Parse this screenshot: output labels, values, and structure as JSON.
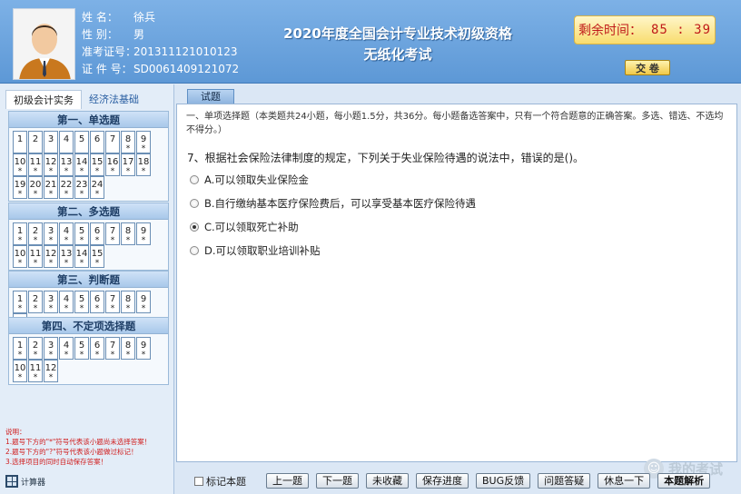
{
  "candidate": {
    "name_label": "姓    名：",
    "name": "徐兵",
    "gender_label": "性    别：",
    "gender": "男",
    "ticket_label": "准考证号：",
    "ticket": "201311121010123",
    "id_label": "证 件 号：",
    "id": "SD0061409121072"
  },
  "exam": {
    "title_line1": "2020年度全国会计专业技术初级资格",
    "title_line2": "无纸化考试"
  },
  "timer": {
    "label": "剩余时间：",
    "minutes": "85",
    "sep": ":",
    "seconds": "39"
  },
  "submit_label": "交 卷",
  "subject_tabs": [
    "初级会计实务",
    "经济法基础"
  ],
  "sections": [
    {
      "title": "第一、单选题",
      "items": [
        {
          "n": "1",
          "m": ""
        },
        {
          "n": "2",
          "m": ""
        },
        {
          "n": "3",
          "m": ""
        },
        {
          "n": "4",
          "m": ""
        },
        {
          "n": "5",
          "m": ""
        },
        {
          "n": "6",
          "m": ""
        },
        {
          "n": "7",
          "m": ""
        },
        {
          "n": "8",
          "m": "*"
        },
        {
          "n": "9",
          "m": "*"
        },
        {
          "n": "10",
          "m": "*"
        },
        {
          "n": "11",
          "m": "*"
        },
        {
          "n": "12",
          "m": "*"
        },
        {
          "n": "13",
          "m": "*"
        },
        {
          "n": "14",
          "m": "*"
        },
        {
          "n": "15",
          "m": "*"
        },
        {
          "n": "16",
          "m": "*"
        },
        {
          "n": "17",
          "m": "*"
        },
        {
          "n": "18",
          "m": "*"
        },
        {
          "n": "19",
          "m": "*"
        },
        {
          "n": "20",
          "m": "*"
        },
        {
          "n": "21",
          "m": "*"
        },
        {
          "n": "22",
          "m": "*"
        },
        {
          "n": "23",
          "m": "*"
        },
        {
          "n": "24",
          "m": "*"
        }
      ]
    },
    {
      "title": "第二、多选题",
      "items": [
        {
          "n": "1",
          "m": "*"
        },
        {
          "n": "2",
          "m": "*"
        },
        {
          "n": "3",
          "m": "*"
        },
        {
          "n": "4",
          "m": "*"
        },
        {
          "n": "5",
          "m": "*"
        },
        {
          "n": "6",
          "m": "*"
        },
        {
          "n": "7",
          "m": "*"
        },
        {
          "n": "8",
          "m": "*"
        },
        {
          "n": "9",
          "m": "*"
        },
        {
          "n": "10",
          "m": "*"
        },
        {
          "n": "11",
          "m": "*"
        },
        {
          "n": "12",
          "m": "*"
        },
        {
          "n": "13",
          "m": "*"
        },
        {
          "n": "14",
          "m": "*"
        },
        {
          "n": "15",
          "m": "*"
        }
      ]
    },
    {
      "title": "第三、判断题",
      "items": [
        {
          "n": "1",
          "m": "*"
        },
        {
          "n": "2",
          "m": "*"
        },
        {
          "n": "3",
          "m": "*"
        },
        {
          "n": "4",
          "m": "*"
        },
        {
          "n": "5",
          "m": "*"
        },
        {
          "n": "6",
          "m": "*"
        },
        {
          "n": "7",
          "m": "*"
        },
        {
          "n": "8",
          "m": "*"
        },
        {
          "n": "9",
          "m": "*"
        },
        {
          "n": "10",
          "m": "*"
        }
      ]
    },
    {
      "title": "第四、不定项选择题",
      "items": [
        {
          "n": "1",
          "m": "*"
        },
        {
          "n": "2",
          "m": "*"
        },
        {
          "n": "3",
          "m": "*"
        },
        {
          "n": "4",
          "m": "*"
        },
        {
          "n": "5",
          "m": "*"
        },
        {
          "n": "6",
          "m": "*"
        },
        {
          "n": "7",
          "m": "*"
        },
        {
          "n": "8",
          "m": "*"
        },
        {
          "n": "9",
          "m": "*"
        },
        {
          "n": "10",
          "m": "*"
        },
        {
          "n": "11",
          "m": "*"
        },
        {
          "n": "12",
          "m": "*"
        }
      ]
    }
  ],
  "notes": {
    "title": "说明：",
    "line1": "1.题号下方的\"*\"符号代表该小题尚未选择答案！",
    "line2": "2.题号下方的\"?\"符号代表该小题做过标记！",
    "line3": "3.选择项目的同时自动保存答案！"
  },
  "calculator_label": "计算器",
  "main_tab": "试题",
  "section_desc": "一、单项选择题（本类题共24小题，每小题1.5分，共36分。每小题备选答案中，只有一个符合题意的正确答案。多选、错选、不选均不得分。）",
  "question": {
    "text": "7、根据社会保险法律制度的规定，下列关于失业保险待遇的说法中，错误的是()。",
    "options": [
      "A.可以领取失业保险金",
      "B.自行缴纳基本医疗保险费后，可以享受基本医疗保险待遇",
      "C.可以领取死亡补助",
      "D.可以领取职业培训补贴"
    ],
    "selected_index": 2
  },
  "watermark": "我的考试",
  "mark_label": "标记本题",
  "buttons": {
    "prev": "上一题",
    "next": "下一题",
    "collect": "未收藏",
    "save": "保存进度",
    "bug": "BUG反馈",
    "qa": "问题答疑",
    "rest": "休息一下",
    "analysis": "本题解析"
  }
}
